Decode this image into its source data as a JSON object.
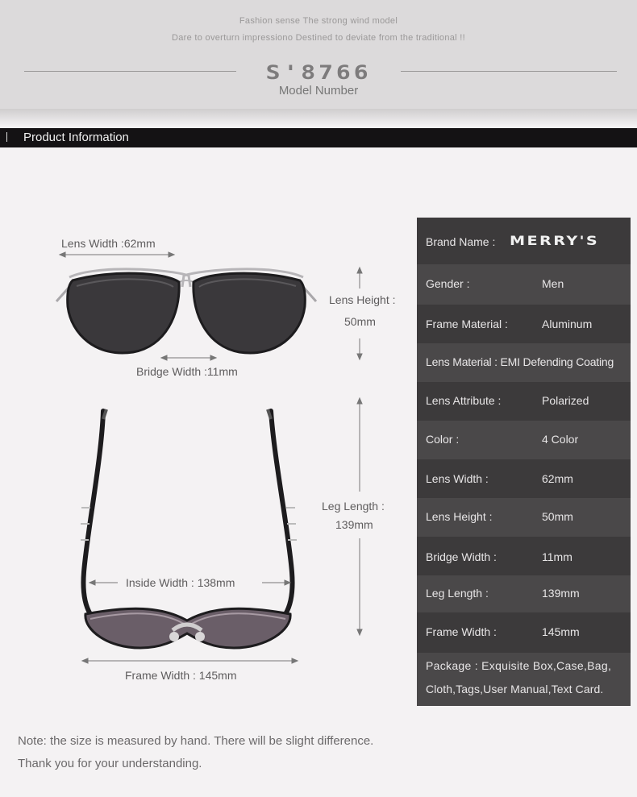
{
  "banner": {
    "tagline_1": "Fashion sense The strong wind model",
    "tagline_2": "Dare to overturn impressiono Destined to deviate from the traditional !!",
    "model_number": "S'8766",
    "model_label": "Model Number"
  },
  "section": {
    "title": "Product Information"
  },
  "diagram": {
    "lens_width": "Lens Width :62mm",
    "lens_height_label": "Lens Height :",
    "lens_height_value": "50mm",
    "bridge_width": "Bridge Width :11mm",
    "leg_length_label": "Leg Length :",
    "leg_length_value": "139mm",
    "inside_width": "Inside  Width : 138mm",
    "frame_width": "Frame Width : 145mm",
    "lens_color": "#3a383b",
    "frame_color": "#b7b5b8"
  },
  "specs": {
    "brand_key": "Brand Name :",
    "brand_logo": "MERRY'S",
    "rows": [
      {
        "key": "Gender :",
        "value": "Men"
      },
      {
        "key": "Frame Material :",
        "value": "Aluminum"
      },
      {
        "key": "Lens Material : EMI Defending Coating",
        "value": ""
      },
      {
        "key": "Lens Attribute :",
        "value": "Polarized"
      },
      {
        "key": "Color :",
        "value": "4 Color"
      },
      {
        "key": "Lens Width :",
        "value": "62mm"
      },
      {
        "key": "Lens Height :",
        "value": "50mm"
      },
      {
        "key": "Bridge Width :",
        "value": "11mm"
      },
      {
        "key": "Leg Length :",
        "value": "139mm"
      },
      {
        "key": "Frame Width :",
        "value": "145mm"
      }
    ],
    "package_line_1": "Package : Exquisite Box,Case,Bag,",
    "package_line_2": "Cloth,Tags,User Manual,Text Card."
  },
  "note": {
    "line_1": "Note: the size is measured by hand. There will be slight difference.",
    "line_2": "Thank you for your understanding."
  }
}
